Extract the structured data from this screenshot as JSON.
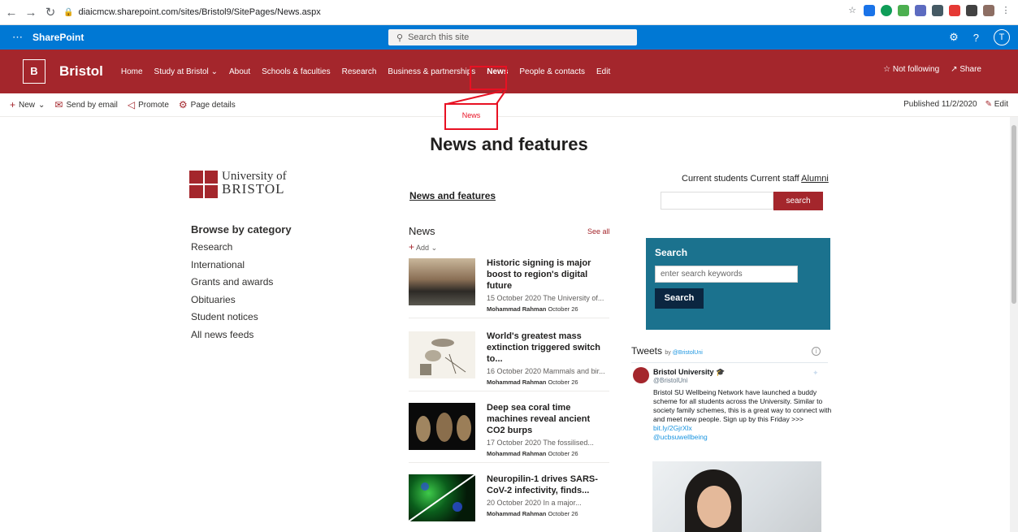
{
  "browser": {
    "url": "diaicmcw.sharepoint.com/sites/Bristol9/SitePages/News.aspx"
  },
  "suite": {
    "app_name": "SharePoint",
    "search_placeholder": "Search this site",
    "help_label": "?",
    "avatar_initial": "T"
  },
  "site": {
    "logo_letter": "B",
    "name": "Bristol",
    "nav": [
      "Home",
      "Study at Bristol",
      "About",
      "Schools & faculties",
      "Research",
      "Business & partnerships",
      "News",
      "People & contacts",
      "Edit"
    ],
    "follow_label": "Not following",
    "share_label": "Share"
  },
  "command_bar": {
    "new_label": "New",
    "send_label": "Send by email",
    "promote_label": "Promote",
    "details_label": "Page details",
    "published": "Published 11/2/2020",
    "edit_label": "Edit"
  },
  "tooltip": {
    "text": "News"
  },
  "page": {
    "title": "News and features",
    "uob_line1": "University of",
    "uob_line2": "BRISTOL",
    "browse_title": "Browse by category",
    "categories": [
      "Research",
      "International",
      "Grants and awards",
      "Obituaries",
      "Student notices",
      "All news feeds"
    ],
    "nf_link": "News and features",
    "news_heading": "News",
    "see_all": "See all",
    "add_label": "Add"
  },
  "news": [
    {
      "title": "Historic signing is major boost to region's digital future",
      "snippet": "15 October 2020 The University of...",
      "author": "Mohammad Rahman",
      "date": "October 26"
    },
    {
      "title": "World's greatest mass extinction triggered switch to...",
      "snippet": "16 October 2020 Mammals and bir...",
      "author": "Mohammad Rahman",
      "date": "October 26"
    },
    {
      "title": "Deep sea coral time machines reveal ancient CO2 burps",
      "snippet": "17 October 2020 The fossilised...",
      "author": "Mohammad Rahman",
      "date": "October 26"
    },
    {
      "title": "Neuropilin-1 drives SARS-CoV-2 infectivity, finds...",
      "snippet": "20 October 2020 In a major...",
      "author": "Mohammad Rahman",
      "date": "October 26"
    }
  ],
  "right": {
    "aud_students": "Current students",
    "aud_staff": "Current staff",
    "aud_alumni": "Alumni",
    "search_btn": "search",
    "panel_title": "Search",
    "panel_placeholder": "enter search keywords",
    "panel_btn": "Search"
  },
  "tweets": {
    "heading": "Tweets",
    "by": "by",
    "handle_link": "@BristolUni",
    "info": "i",
    "name": "Bristol University",
    "handle": "@BristolUni",
    "text": "Bristol SU Wellbeing Network have launched a buddy scheme for all students across the University. Similar to society family schemes, this is a great way to connect with and meet new people. Sign up by this Friday >>> ",
    "link1": "bit.ly/2GjrXlx",
    "link2": "@ucbsuwellbeing"
  },
  "colors": {
    "suite_blue": "#0078d4",
    "brand_red": "#a4262c",
    "panel_teal": "#1b728e",
    "highlight_red": "#e81123"
  }
}
